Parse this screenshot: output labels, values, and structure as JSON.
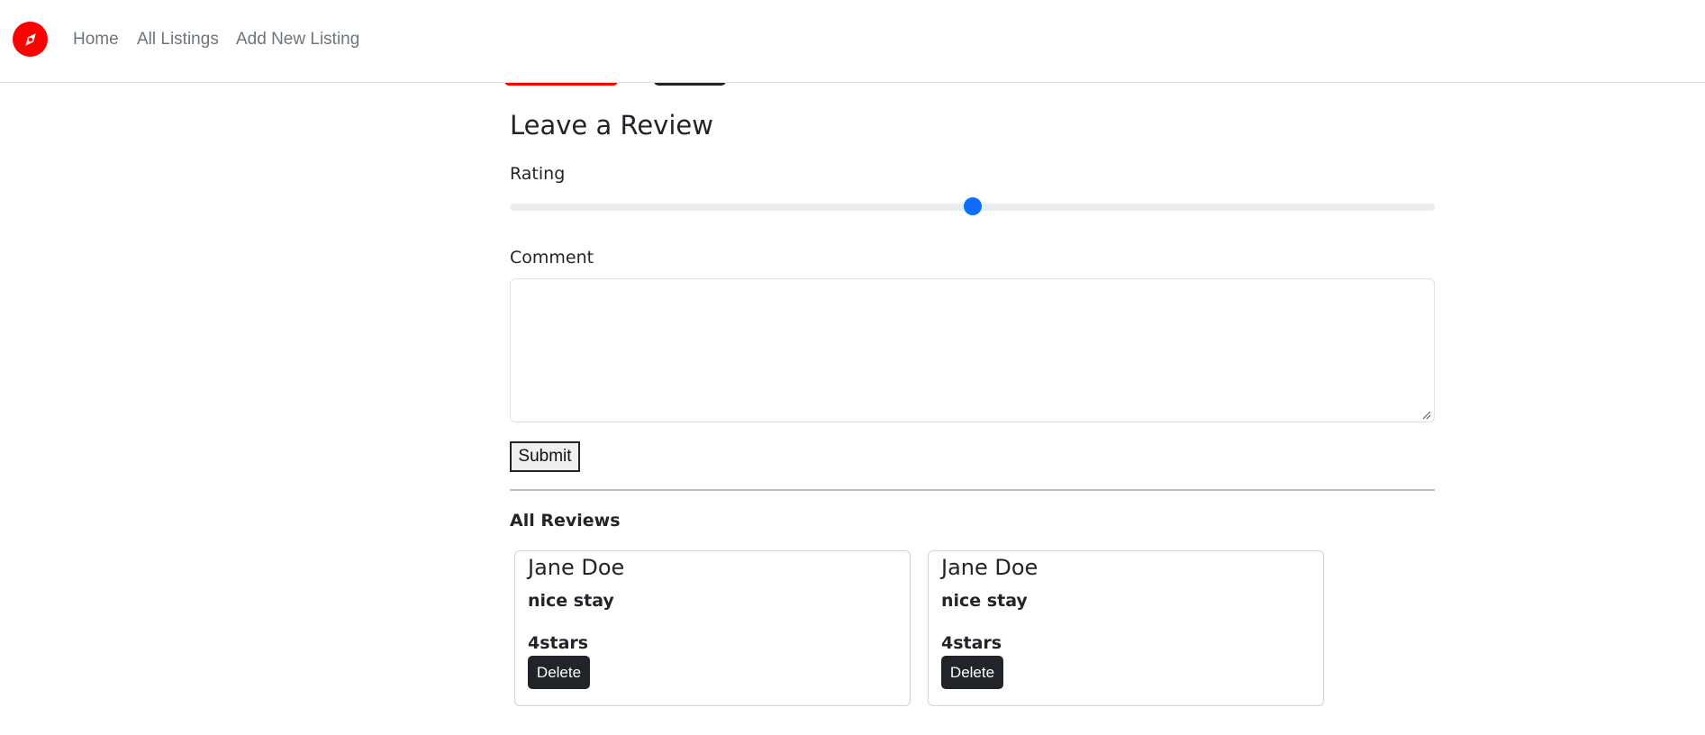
{
  "nav": {
    "brand_icon": "compass-icon",
    "brand_color": "#fe0000",
    "links": [
      "Home",
      "All Listings",
      "Add New Listing"
    ]
  },
  "review_form": {
    "title": "Leave a Review",
    "rating_label": "Rating",
    "rating_value": 3,
    "rating_min": 1,
    "rating_max": 5,
    "comment_label": "Comment",
    "comment_value": "",
    "submit_label": "Submit"
  },
  "reviews": {
    "heading": "All Reviews",
    "items": [
      {
        "author": "Jane Doe",
        "comment": "nice stay",
        "rating": "4stars",
        "delete_label": "Delete"
      },
      {
        "author": "Jane Doe",
        "comment": "nice stay",
        "rating": "4stars",
        "delete_label": "Delete"
      }
    ]
  },
  "colors": {
    "accent": "#0d6efd",
    "dark_button": "#212529"
  }
}
